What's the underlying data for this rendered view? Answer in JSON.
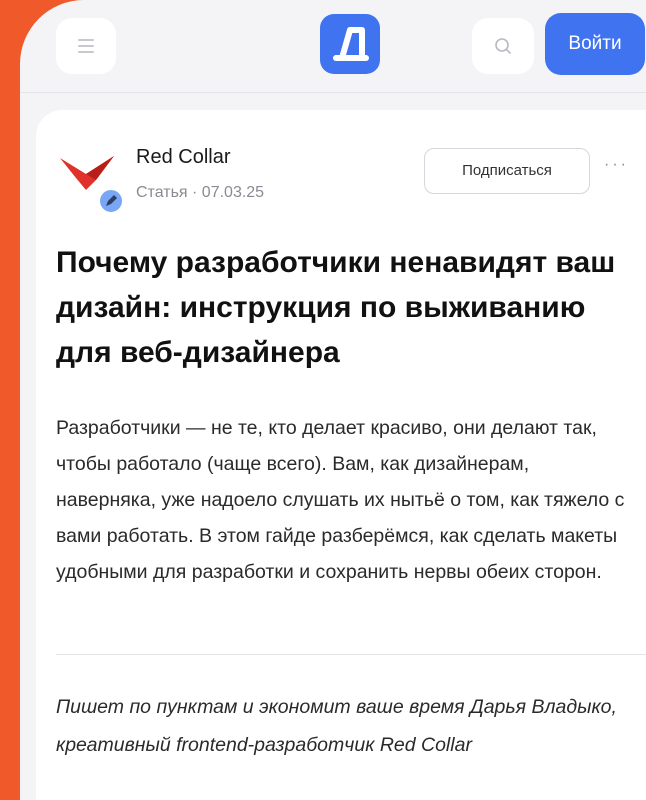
{
  "header": {
    "menu_icon": "hamburger-menu-icon",
    "logo_icon": "app-logo-icon",
    "search_icon": "search-icon",
    "login_label": "Войти",
    "accent_color": "#3f73f0"
  },
  "post": {
    "author": "Red Collar",
    "author_logo_icon": "red-collar-logo-icon",
    "badge_icon": "pencil-badge-icon",
    "meta": "Статья · 07.03.25",
    "subscribe_label": "Подписаться",
    "more_label": "···",
    "title": "Почему разработчики ненавидят ваш дизайн: инструкция по выживанию для веб-дизайнера",
    "lead": "Разработчики — не те, кто делает красиво, они делают так, чтобы работало (чаще всего). Вам, как дизайнерам, наверняка, уже надоело слушать их нытьё о том, как тяжело с вами работать. В этом гайде разберёмся, как сделать макеты удобными для разработки и сохранить нервы обеих сторон.",
    "byline": "Пишет по пунктам и экономит ваше время Дарья Владыко, креативный frontend-разработчик Red Collar"
  },
  "background_color": "#f05a2b"
}
